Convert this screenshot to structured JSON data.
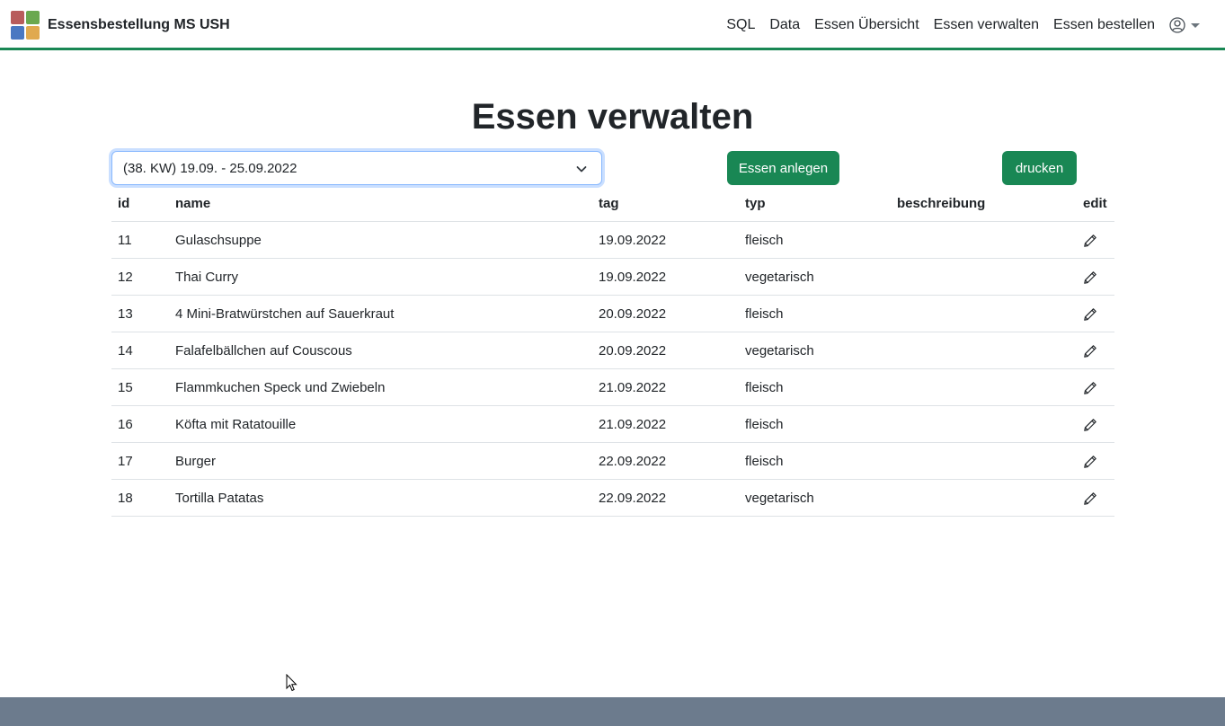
{
  "app": {
    "brand": "Essensbestellung MS USH"
  },
  "nav": {
    "items": [
      "SQL",
      "Data",
      "Essen Übersicht",
      "Essen verwalten",
      "Essen bestellen"
    ]
  },
  "page": {
    "title": "Essen verwalten"
  },
  "week_select": {
    "value": "(38. KW) 19.09. - 25.09.2022"
  },
  "buttons": {
    "add": "Essen anlegen",
    "print": "drucken"
  },
  "table": {
    "headers": [
      "id",
      "name",
      "tag",
      "typ",
      "beschreibung",
      "edit"
    ],
    "rows": [
      {
        "id": "11",
        "name": "Gulaschsuppe",
        "tag": "19.09.2022",
        "typ": "fleisch",
        "beschreibung": ""
      },
      {
        "id": "12",
        "name": "Thai Curry",
        "tag": "19.09.2022",
        "typ": "vegetarisch",
        "beschreibung": ""
      },
      {
        "id": "13",
        "name": "4 Mini-Bratwürstchen auf Sauerkraut",
        "tag": "20.09.2022",
        "typ": "fleisch",
        "beschreibung": ""
      },
      {
        "id": "14",
        "name": "Falafelbällchen auf Couscous",
        "tag": "20.09.2022",
        "typ": "vegetarisch",
        "beschreibung": ""
      },
      {
        "id": "15",
        "name": "Flammkuchen Speck und Zwiebeln",
        "tag": "21.09.2022",
        "typ": "fleisch",
        "beschreibung": ""
      },
      {
        "id": "16",
        "name": "Köfta mit Ratatouille",
        "tag": "21.09.2022",
        "typ": "fleisch",
        "beschreibung": ""
      },
      {
        "id": "17",
        "name": "Burger",
        "tag": "22.09.2022",
        "typ": "fleisch",
        "beschreibung": ""
      },
      {
        "id": "18",
        "name": "Tortilla Patatas",
        "tag": "22.09.2022",
        "typ": "vegetarisch",
        "beschreibung": ""
      }
    ]
  },
  "icons": {
    "edit": "pencil-icon",
    "user": "user-circle-icon",
    "dropdown": "chevron-down-icon",
    "logo": "app-logo"
  },
  "colors": {
    "accent": "#198754",
    "footer": "#6c7b8d",
    "focus": "#86b7fe"
  }
}
